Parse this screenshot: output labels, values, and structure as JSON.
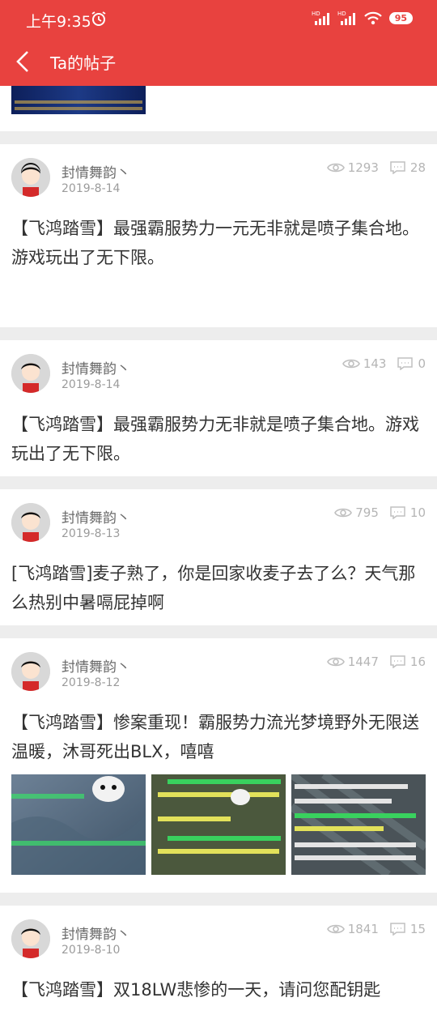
{
  "status_bar": {
    "time": "上午9:35",
    "battery": "95"
  },
  "nav": {
    "title": "Ta的帖子"
  },
  "posts": [
    {
      "author": "封情舞韵丶",
      "date": "2019-8-14",
      "views": "1293",
      "comments": "28",
      "content": "【飞鸿踏雪】最强霸服势力一元无非就是喷子集合地。游戏玩出了无下限。"
    },
    {
      "author": "封情舞韵丶",
      "date": "2019-8-14",
      "views": "143",
      "comments": "0",
      "content": "【飞鸿踏雪】最强霸服势力无非就是喷子集合地。游戏玩出了无下限。"
    },
    {
      "author": "封情舞韵丶",
      "date": "2019-8-13",
      "views": "795",
      "comments": "10",
      "content": "[飞鸿踏雪]麦子熟了，你是回家收麦子去了么？天气那么热别中暑嗝屁掉啊"
    },
    {
      "author": "封情舞韵丶",
      "date": "2019-8-12",
      "views": "1447",
      "comments": "16",
      "content": "【飞鸿踏雪】惨案重现！霸服势力流光梦境野外无限送温暖，沐哥死出BLX，嘻嘻"
    },
    {
      "author": "封情舞韵丶",
      "date": "2019-8-10",
      "views": "1841",
      "comments": "15",
      "content": "【飞鸿踏雪】双18LW悲惨的一天，请问您配钥匙"
    }
  ],
  "icons": {
    "back": "back-arrow-icon",
    "views": "eye-icon",
    "comments": "comment-icon",
    "alarm": "alarm-icon",
    "wifi": "wifi-icon"
  },
  "colors": {
    "brand": "#e8423f",
    "meta": "#9b9b9b",
    "text": "#333333"
  }
}
